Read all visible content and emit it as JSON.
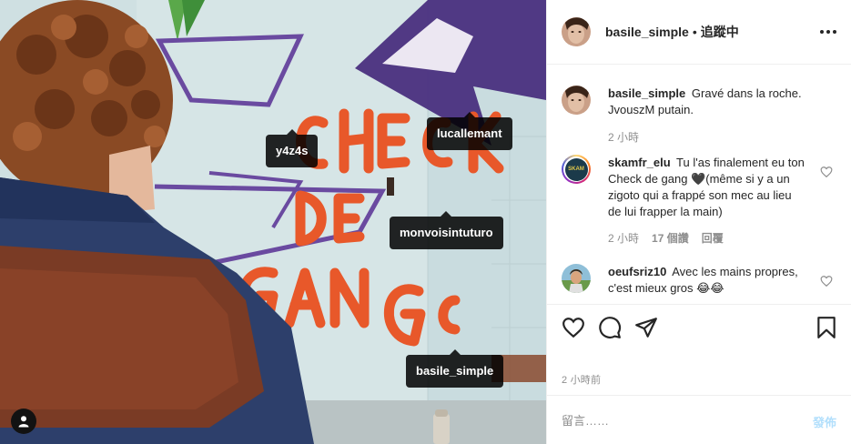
{
  "post": {
    "author": "basile_simple",
    "dot": "•",
    "follow_status": "追蹤中",
    "time_ago": "2 小時前"
  },
  "photo": {
    "tags": [
      {
        "name": "y4z4s"
      },
      {
        "name": "lucallemant"
      },
      {
        "name": "monvoisintuturo"
      },
      {
        "name": "basile_simple"
      }
    ]
  },
  "comments": [
    {
      "user": "basile_simple",
      "text": "Gravé dans la roche. JvouszM putain.",
      "time": "2 小時"
    },
    {
      "user": "skamfr_elu",
      "text": "Tu l'as finalement eu ton Check de gang 🖤(même si y a un zigoto qui a frappé son mec au lieu de lui frapper la main)",
      "time": "2 小時",
      "likes": "17 個讚",
      "reply": "回覆",
      "avatar_text": "SKAM"
    },
    {
      "user": "oeufsriz10",
      "text": "Avec les mains propres, c'est mieux gros 😂😂"
    }
  ],
  "composer": {
    "placeholder": "留言……",
    "post_label": "發佈"
  },
  "icons": {
    "more": "more-options-icon",
    "like": "heart-icon",
    "comment": "comment-icon",
    "share": "paper-plane-icon",
    "save": "bookmark-icon",
    "user_tags": "user-tags-icon"
  },
  "colors": {
    "text": "#262626",
    "muted": "#8e8e8e",
    "border": "#efefef",
    "post_disabled": "#b2dffc",
    "graffiti_orange": "#e8582a",
    "graffiti_purple": "#5b3a8e"
  }
}
